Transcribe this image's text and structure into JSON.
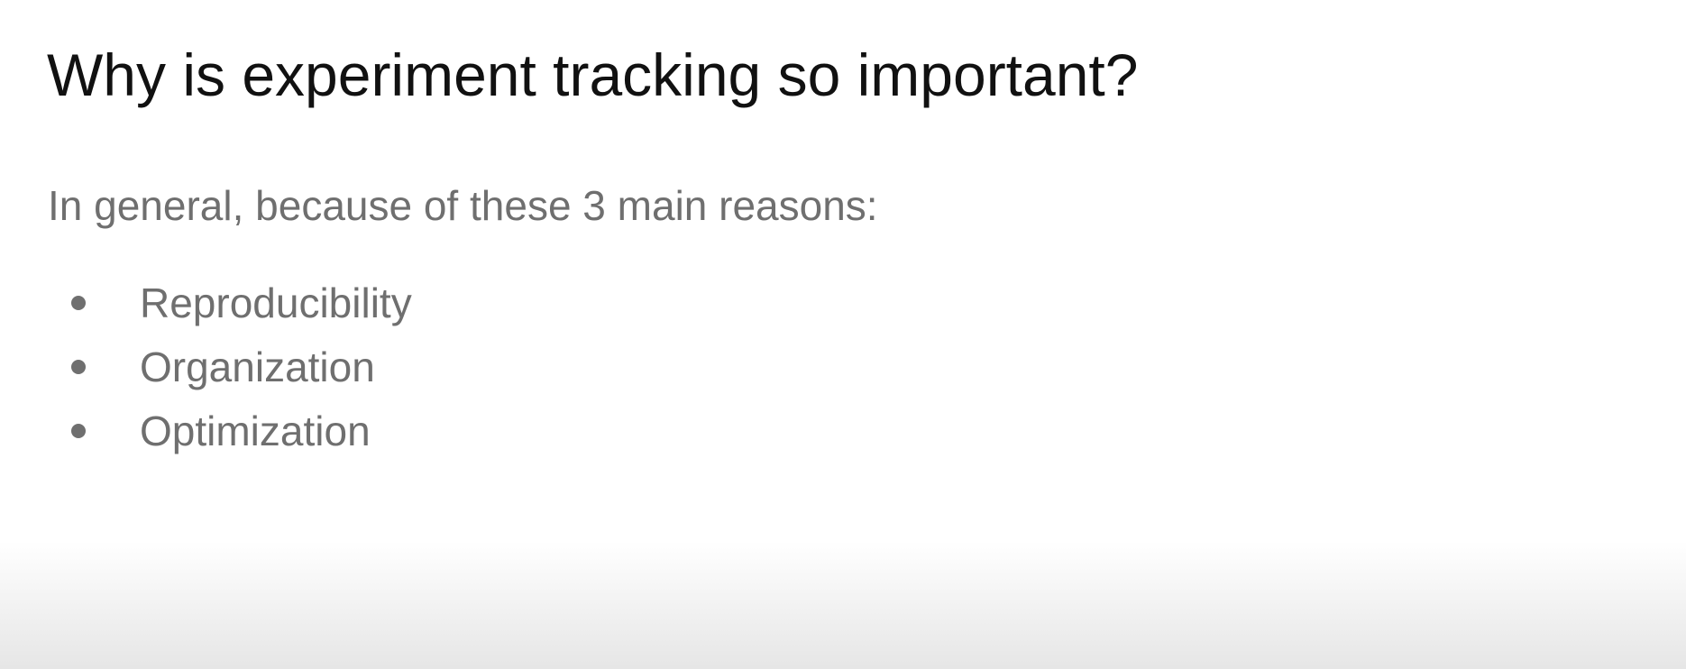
{
  "slide": {
    "title": "Why is experiment tracking so important?",
    "intro": "In general, because of these 3 main reasons:",
    "bullets": [
      "Reproducibility",
      "Organization",
      "Optimization"
    ]
  }
}
